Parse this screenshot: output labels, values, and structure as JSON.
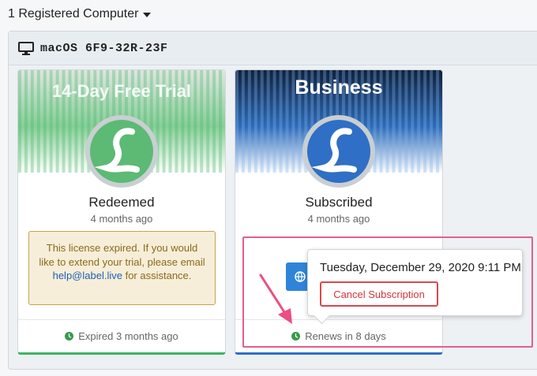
{
  "header": {
    "title": "1 Registered Computer",
    "caret_icon": "caret-down-icon"
  },
  "computer": {
    "icon": "monitor-icon",
    "name": "macOS 6F9-32R-23F"
  },
  "cards": [
    {
      "banner_title": "14-Day Free Trial",
      "banner_color": "#5fbf7a",
      "status": "Redeemed",
      "date": "4 months ago",
      "notice_text": "This license expired. If you would like to extend your trial, please email",
      "notice_link": "help@label.live",
      "notice_tail": "for assistance.",
      "footer_text": "Expired 3 months ago"
    },
    {
      "banner_title": "Business",
      "banner_color": "#1e4f91",
      "status": "Subscribed",
      "date": "4 months ago",
      "footer_text": "Renews in 8 days"
    }
  ],
  "popover": {
    "date": "Tuesday, December 29, 2020 9:11 PM",
    "cancel_label": "Cancel Subscription"
  },
  "colors": {
    "highlight": "#e35f8c",
    "cancel": "#d8484e",
    "clock": "#3a9a4b",
    "link": "#1d5fb8"
  }
}
